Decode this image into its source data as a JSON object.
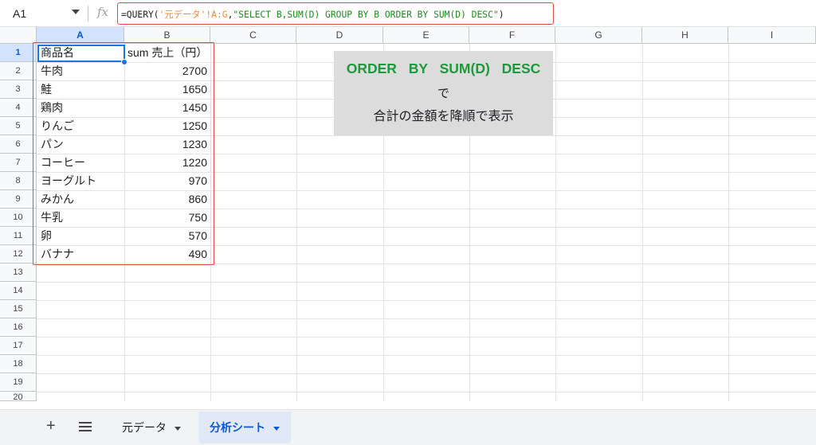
{
  "formula_bar": {
    "cell_ref": "A1",
    "fx_label": "fx",
    "formula_prefix": "=QUERY(",
    "formula_range": "'元データ'!A:G",
    "formula_comma": ",",
    "formula_string": "\"SELECT B,SUM(D) GROUP BY B ORDER BY SUM(D) DESC\"",
    "formula_suffix": ")"
  },
  "columns": [
    "A",
    "B",
    "C",
    "D",
    "E",
    "F",
    "G",
    "H",
    "I"
  ],
  "rows": [
    "1",
    "2",
    "3",
    "4",
    "5",
    "6",
    "7",
    "8",
    "9",
    "10",
    "11",
    "12",
    "13",
    "14",
    "15",
    "16",
    "17",
    "18",
    "19",
    "20"
  ],
  "table": {
    "header": {
      "a": "商品名",
      "b": "sum 売上（円）"
    },
    "rows": [
      {
        "a": "牛肉",
        "b": "2700"
      },
      {
        "a": "鮭",
        "b": "1650"
      },
      {
        "a": "鶏肉",
        "b": "1450"
      },
      {
        "a": "りんご",
        "b": "1250"
      },
      {
        "a": "パン",
        "b": "1230"
      },
      {
        "a": "コーヒー",
        "b": "1220"
      },
      {
        "a": "ヨーグルト",
        "b": "970"
      },
      {
        "a": "みかん",
        "b": "860"
      },
      {
        "a": "牛乳",
        "b": "750"
      },
      {
        "a": "卵",
        "b": "570"
      },
      {
        "a": "バナナ",
        "b": "490"
      }
    ]
  },
  "note": {
    "line1": "ORDER BY SUM(D) DESC",
    "line2": "で",
    "line3": "合計の金額を降順で表示"
  },
  "sheet_tabs": {
    "add_label": "+",
    "tabs": [
      {
        "label": "元データ",
        "active": false
      },
      {
        "label": "分析シート",
        "active": true
      }
    ]
  },
  "colors": {
    "selection": "#1a73e8",
    "highlight_box": "#e24a4a",
    "note_text_green": "#1e9a3a",
    "formula_range": "#e8893b",
    "formula_string": "#1e8a1e"
  }
}
